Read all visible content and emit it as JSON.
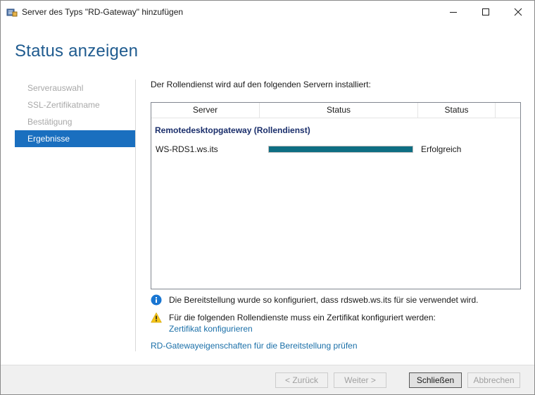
{
  "window": {
    "title": "Server des Typs \"RD-Gateway\" hinzufügen",
    "controls": [
      "minimize-icon",
      "maximize-icon",
      "close-icon"
    ]
  },
  "page_title": "Status anzeigen",
  "nav": {
    "items": [
      {
        "label": "Serverauswahl",
        "active": false
      },
      {
        "label": "SSL-Zertifikatname",
        "active": false
      },
      {
        "label": "Bestätigung",
        "active": false
      },
      {
        "label": "Ergebnisse",
        "active": true
      }
    ]
  },
  "content": {
    "intro": "Der Rollendienst wird auf den folgenden Servern installiert:",
    "table": {
      "columns": [
        "Server",
        "Status",
        "Status"
      ],
      "group": "Remotedesktopgateway (Rollendienst)",
      "rows": [
        {
          "server": "WS-RDS1.ws.its",
          "progress": 1.0,
          "status": "Erfolgreich"
        }
      ]
    },
    "info_message": "Die Bereitstellung wurde so konfiguriert, dass rdsweb.ws.its für sie verwendet wird.",
    "warning_message": "Für die folgenden Rollendienste muss ein Zertifikat konfiguriert werden:",
    "warning_link": "Zertifikat konfigurieren",
    "bottom_link": "RD-Gatewayeigenschaften für die Bereitstellung prüfen"
  },
  "buttons": {
    "back": "< Zurück",
    "next": "Weiter >",
    "close": "Schließen",
    "cancel": "Abbrechen"
  },
  "colors": {
    "accent": "#1a6fbf",
    "title": "#1f5b8f",
    "progress": "#0e6e83",
    "link": "#1a6fa8"
  }
}
